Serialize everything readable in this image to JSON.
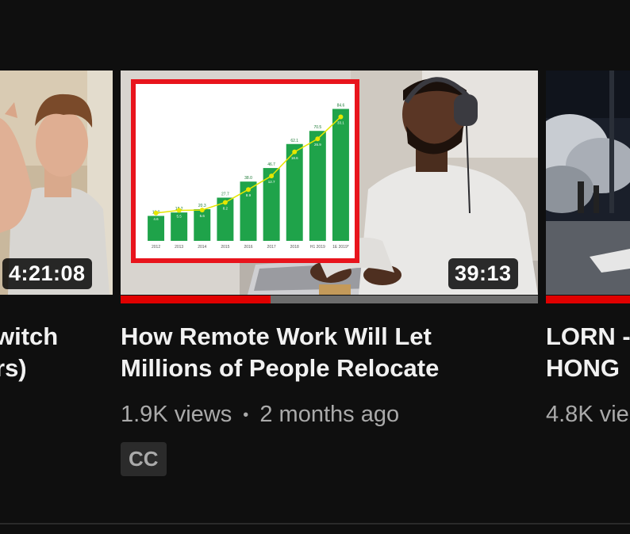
{
  "videos": [
    {
      "title_lines": [
        "witch",
        "rs)"
      ],
      "duration": "4:21:08"
    },
    {
      "title_lines": [
        "How Remote Work Will Let",
        "Millions of People Relocate"
      ],
      "duration": "39:13",
      "views": "1.9K views",
      "separator": "•",
      "age": "2 months ago",
      "badge": "CC",
      "watch_progress": 0.36,
      "chart_data": {
        "type": "bar",
        "categories": [
          "2012",
          "2013",
          "2014",
          "2015",
          "2016",
          "2017",
          "2018",
          "H1 2019",
          "1E 2019*"
        ],
        "values": [
          16.0,
          18.2,
          20.3,
          27.7,
          38.0,
          46.7,
          62.1,
          70.5,
          84.6
        ],
        "line_values": [
          4.6,
          5.5,
          5.6,
          8.2,
          8.9,
          12.7,
          18.6,
          26.9,
          33.1
        ],
        "value_labels": [
          "16.0",
          "18.2",
          "20.3",
          "27.7",
          "38.0",
          "46.7",
          "62.1",
          "70.5",
          "84.6"
        ],
        "line_labels": [
          "4.6",
          "5.5",
          "5.6",
          "8.2",
          "8.9",
          "12.7",
          "18.6",
          "26.9",
          "33.1"
        ],
        "title": "",
        "xlabel": "",
        "ylabel": "",
        "ylim": [
          0,
          95
        ],
        "bar_color": "#1fa34a",
        "line_color": "#e6e600",
        "frame_color": "#e8141c"
      }
    },
    {
      "title_lines": [
        "LORN -",
        "HONG"
      ],
      "views": "4.8K vie",
      "watch_progress": 1.0
    }
  ],
  "colors": {
    "background": "#0f0f0f",
    "progress": "#e00000",
    "title": "#f1f1f1",
    "meta": "#aaaaaa"
  }
}
